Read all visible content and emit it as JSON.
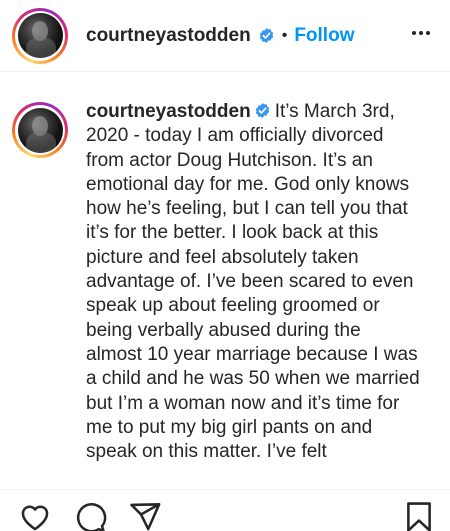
{
  "post": {
    "username": "courtneyastodden",
    "follow_label": "Follow",
    "separator": "•",
    "caption": "It’s March 3rd, 2020 - today I am officially divorced from actor Doug Hutchison. It’s an emotional day for me. God only knows how he’s feeling, but I can tell you that it’s for the better. I look back at this picture and feel absolutely taken advantage of. I’ve been scared to even speak up about feeling groomed or being verbally abused during the almost 10 year marriage because I was a child and he was 50 when we married but I’m a woman now and it’s time for me to put my big girl pants on and speak on this matter. I’ve felt"
  },
  "icons": {
    "verified": "verified-badge-icon",
    "more": "more-options-icon",
    "like": "heart-icon",
    "comment": "comment-icon",
    "share": "paper-plane-icon",
    "save": "bookmark-icon"
  },
  "colors": {
    "link": "#0095f6",
    "text": "#262626",
    "divider": "#efefef"
  }
}
